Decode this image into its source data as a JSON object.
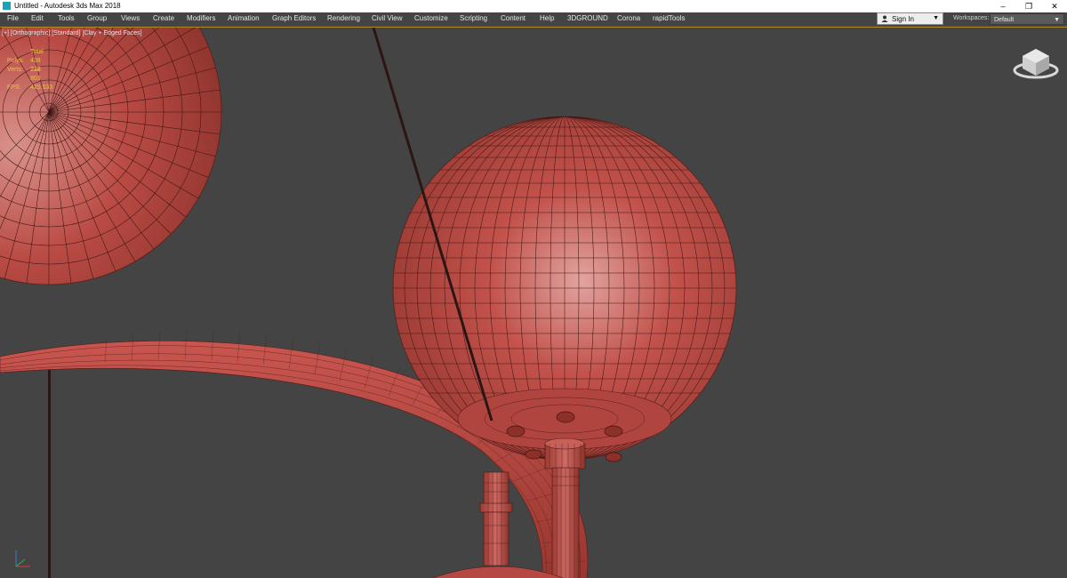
{
  "window": {
    "title": "Untitled - Autodesk 3ds Max 2018",
    "minimize_glyph": "–",
    "restore_glyph": "❐",
    "close_glyph": "✕"
  },
  "menu": {
    "items": [
      "File",
      "Edit",
      "Tools",
      "Group",
      "Views",
      "Create",
      "Modifiers",
      "Animation",
      "Graph Editors",
      "Rendering",
      "Civil View",
      "Customize",
      "Scripting",
      "Content",
      "Help",
      "3DGROUND",
      "Corona",
      "rapidTools"
    ]
  },
  "signin": {
    "label": "Sign In",
    "caret": "▼"
  },
  "workspaces": {
    "label": "Workspaces:",
    "value": "Default",
    "caret": "▼"
  },
  "viewport": {
    "label": "[+] [Orthographic] [Standard] [Clay + Edged Faces]",
    "stats": [
      {
        "key": "",
        "value": "Total"
      },
      {
        "key": "Polys:",
        "value": "438 228"
      },
      {
        "key": "Verts:",
        "value": "232 803"
      },
      {
        "key": "",
        "value": ""
      },
      {
        "key": "FPS:",
        "value": "425.533"
      }
    ],
    "clay_color": "#c0504a",
    "background": "#444444"
  },
  "icons": {
    "app": "3dsmax-app-icon",
    "user": "user-icon",
    "viewcube": "viewcube-icon",
    "axis": "axis-tripod-icon"
  }
}
